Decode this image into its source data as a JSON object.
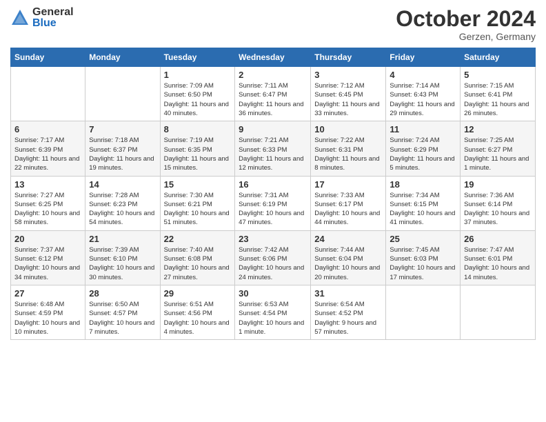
{
  "header": {
    "logo_general": "General",
    "logo_blue": "Blue",
    "month_title": "October 2024",
    "subtitle": "Gerzen, Germany"
  },
  "weekdays": [
    "Sunday",
    "Monday",
    "Tuesday",
    "Wednesday",
    "Thursday",
    "Friday",
    "Saturday"
  ],
  "rows": [
    [
      {
        "day": "",
        "info": ""
      },
      {
        "day": "",
        "info": ""
      },
      {
        "day": "1",
        "info": "Sunrise: 7:09 AM\nSunset: 6:50 PM\nDaylight: 11 hours and 40 minutes."
      },
      {
        "day": "2",
        "info": "Sunrise: 7:11 AM\nSunset: 6:47 PM\nDaylight: 11 hours and 36 minutes."
      },
      {
        "day": "3",
        "info": "Sunrise: 7:12 AM\nSunset: 6:45 PM\nDaylight: 11 hours and 33 minutes."
      },
      {
        "day": "4",
        "info": "Sunrise: 7:14 AM\nSunset: 6:43 PM\nDaylight: 11 hours and 29 minutes."
      },
      {
        "day": "5",
        "info": "Sunrise: 7:15 AM\nSunset: 6:41 PM\nDaylight: 11 hours and 26 minutes."
      }
    ],
    [
      {
        "day": "6",
        "info": "Sunrise: 7:17 AM\nSunset: 6:39 PM\nDaylight: 11 hours and 22 minutes."
      },
      {
        "day": "7",
        "info": "Sunrise: 7:18 AM\nSunset: 6:37 PM\nDaylight: 11 hours and 19 minutes."
      },
      {
        "day": "8",
        "info": "Sunrise: 7:19 AM\nSunset: 6:35 PM\nDaylight: 11 hours and 15 minutes."
      },
      {
        "day": "9",
        "info": "Sunrise: 7:21 AM\nSunset: 6:33 PM\nDaylight: 11 hours and 12 minutes."
      },
      {
        "day": "10",
        "info": "Sunrise: 7:22 AM\nSunset: 6:31 PM\nDaylight: 11 hours and 8 minutes."
      },
      {
        "day": "11",
        "info": "Sunrise: 7:24 AM\nSunset: 6:29 PM\nDaylight: 11 hours and 5 minutes."
      },
      {
        "day": "12",
        "info": "Sunrise: 7:25 AM\nSunset: 6:27 PM\nDaylight: 11 hours and 1 minute."
      }
    ],
    [
      {
        "day": "13",
        "info": "Sunrise: 7:27 AM\nSunset: 6:25 PM\nDaylight: 10 hours and 58 minutes."
      },
      {
        "day": "14",
        "info": "Sunrise: 7:28 AM\nSunset: 6:23 PM\nDaylight: 10 hours and 54 minutes."
      },
      {
        "day": "15",
        "info": "Sunrise: 7:30 AM\nSunset: 6:21 PM\nDaylight: 10 hours and 51 minutes."
      },
      {
        "day": "16",
        "info": "Sunrise: 7:31 AM\nSunset: 6:19 PM\nDaylight: 10 hours and 47 minutes."
      },
      {
        "day": "17",
        "info": "Sunrise: 7:33 AM\nSunset: 6:17 PM\nDaylight: 10 hours and 44 minutes."
      },
      {
        "day": "18",
        "info": "Sunrise: 7:34 AM\nSunset: 6:15 PM\nDaylight: 10 hours and 41 minutes."
      },
      {
        "day": "19",
        "info": "Sunrise: 7:36 AM\nSunset: 6:14 PM\nDaylight: 10 hours and 37 minutes."
      }
    ],
    [
      {
        "day": "20",
        "info": "Sunrise: 7:37 AM\nSunset: 6:12 PM\nDaylight: 10 hours and 34 minutes."
      },
      {
        "day": "21",
        "info": "Sunrise: 7:39 AM\nSunset: 6:10 PM\nDaylight: 10 hours and 30 minutes."
      },
      {
        "day": "22",
        "info": "Sunrise: 7:40 AM\nSunset: 6:08 PM\nDaylight: 10 hours and 27 minutes."
      },
      {
        "day": "23",
        "info": "Sunrise: 7:42 AM\nSunset: 6:06 PM\nDaylight: 10 hours and 24 minutes."
      },
      {
        "day": "24",
        "info": "Sunrise: 7:44 AM\nSunset: 6:04 PM\nDaylight: 10 hours and 20 minutes."
      },
      {
        "day": "25",
        "info": "Sunrise: 7:45 AM\nSunset: 6:03 PM\nDaylight: 10 hours and 17 minutes."
      },
      {
        "day": "26",
        "info": "Sunrise: 7:47 AM\nSunset: 6:01 PM\nDaylight: 10 hours and 14 minutes."
      }
    ],
    [
      {
        "day": "27",
        "info": "Sunrise: 6:48 AM\nSunset: 4:59 PM\nDaylight: 10 hours and 10 minutes."
      },
      {
        "day": "28",
        "info": "Sunrise: 6:50 AM\nSunset: 4:57 PM\nDaylight: 10 hours and 7 minutes."
      },
      {
        "day": "29",
        "info": "Sunrise: 6:51 AM\nSunset: 4:56 PM\nDaylight: 10 hours and 4 minutes."
      },
      {
        "day": "30",
        "info": "Sunrise: 6:53 AM\nSunset: 4:54 PM\nDaylight: 10 hours and 1 minute."
      },
      {
        "day": "31",
        "info": "Sunrise: 6:54 AM\nSunset: 4:52 PM\nDaylight: 9 hours and 57 minutes."
      },
      {
        "day": "",
        "info": ""
      },
      {
        "day": "",
        "info": ""
      }
    ]
  ]
}
